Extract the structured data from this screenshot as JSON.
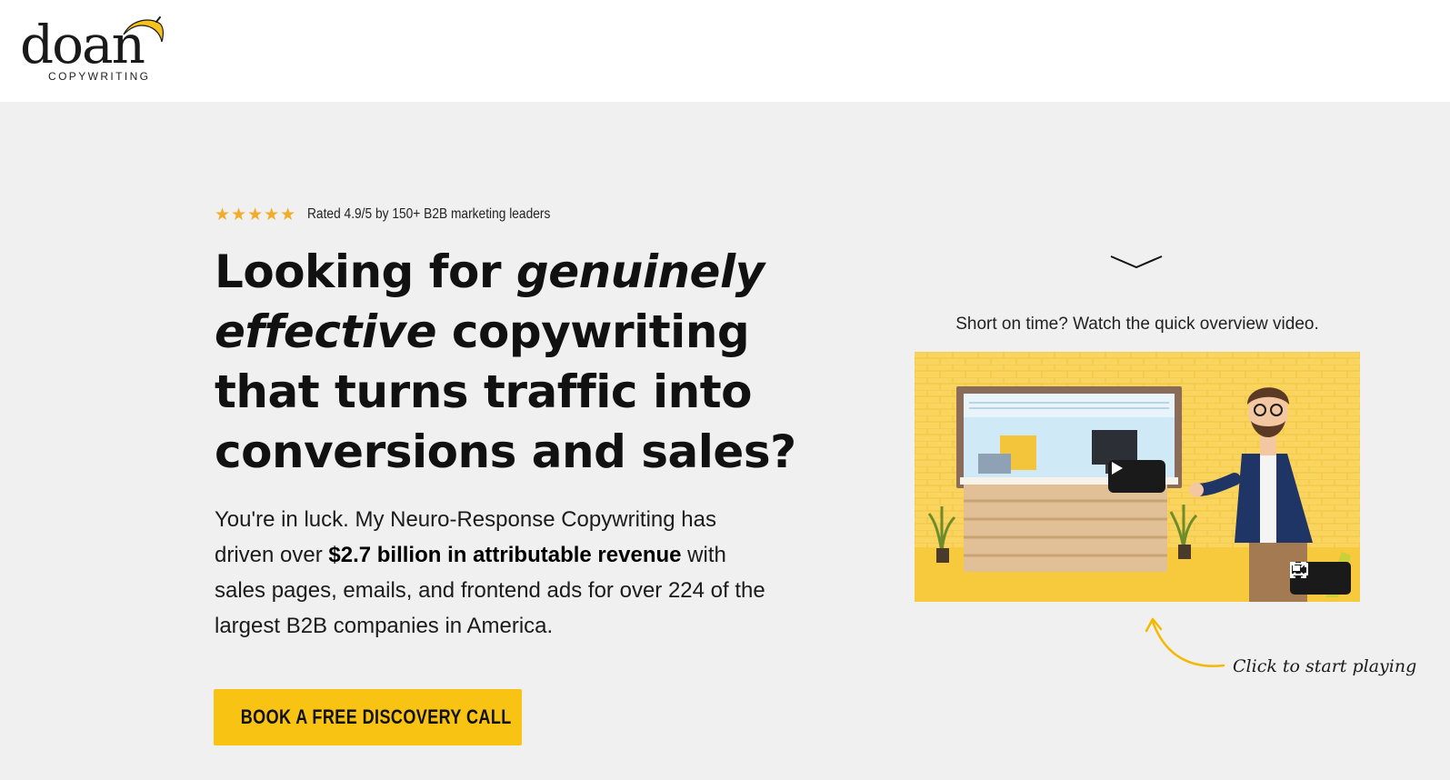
{
  "brand": {
    "logo_word": "doan",
    "logo_sub": "COPYWRITING",
    "accent": "#f8c313",
    "background": "#f0f0f0",
    "header_background": "#ffffff"
  },
  "rating": {
    "stars": "★★★★★",
    "star_count": 5,
    "text": "Rated 4.9/5 by 150+ B2B marketing leaders",
    "star_color": "#f0ad2a"
  },
  "headline": {
    "part1": "Looking for ",
    "em1": "genuinely",
    "em2": "effective",
    "part2": " copywriting that turns traffic into conversions and sales?"
  },
  "body": {
    "intro": "You're in luck. My Neuro-Response Copywriting has driven over ",
    "highlight": "$2.7 billion in attributable revenue",
    "outro": " with sales pages, emails, and frontend ads for over 224 of the largest B2B companies in America."
  },
  "cta": {
    "label": "BOOK A FREE DISCOVERY CALL",
    "icon": "phone-icon"
  },
  "video": {
    "caption": "Short on time? Watch the quick overview video.",
    "play_icon": "play-icon",
    "controls": [
      "picture-in-picture-icon",
      "fullscreen-icon"
    ]
  },
  "hint": {
    "text": "Click to start playing",
    "icon": "curved-arrow-icon"
  },
  "decor": {
    "chevron_icon": "chevron-down-icon"
  }
}
